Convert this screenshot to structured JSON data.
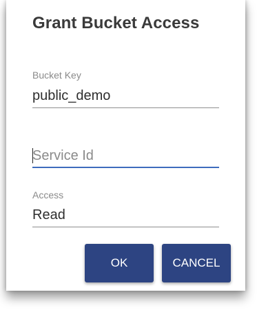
{
  "dialog": {
    "title": "Grant Bucket Access",
    "bucket_key": {
      "label": "Bucket Key",
      "value": "public_demo"
    },
    "service_id": {
      "placeholder": "Service Id",
      "value": ""
    },
    "access": {
      "label": "Access",
      "value": "Read"
    },
    "buttons": {
      "ok": "OK",
      "cancel": "CANCEL"
    }
  },
  "colors": {
    "accent": "#2d4482",
    "focus_underline": "#3e6cbd"
  }
}
